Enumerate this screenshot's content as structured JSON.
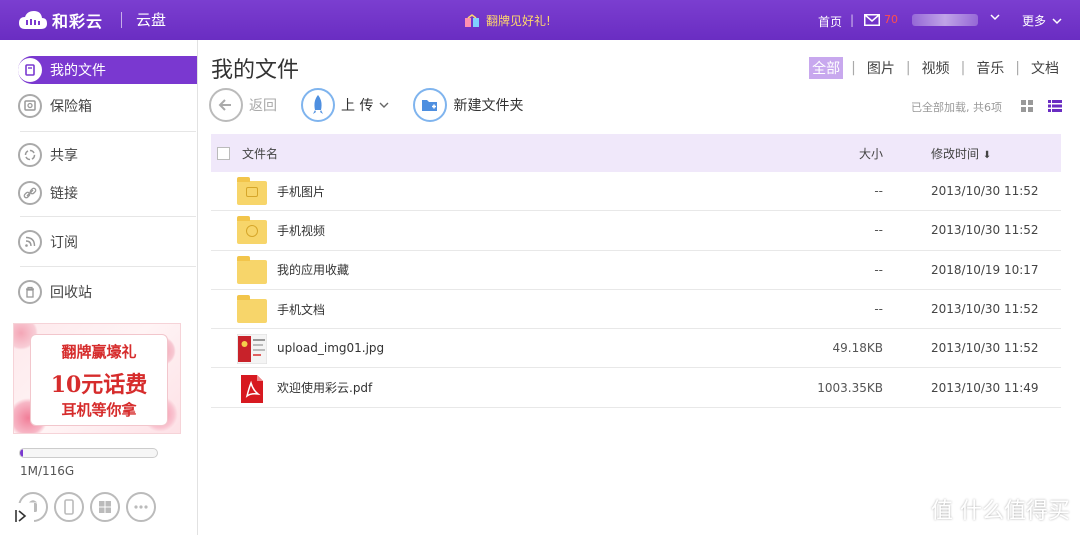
{
  "header": {
    "brand": "和彩云",
    "app_name": "云盘",
    "promo": "翻牌见好礼!",
    "home": "首页",
    "sep": "|",
    "mail_count": "70",
    "more": "更多"
  },
  "sidebar": {
    "items": [
      {
        "label": "我的文件",
        "icon": "my-files-icon"
      },
      {
        "label": "保险箱",
        "icon": "safe-icon"
      },
      {
        "label": "共享",
        "icon": "share-icon"
      },
      {
        "label": "链接",
        "icon": "link-icon"
      },
      {
        "label": "订阅",
        "icon": "rss-icon"
      },
      {
        "label": "回收站",
        "icon": "recycle-bin-icon"
      }
    ],
    "ad": {
      "line1": "翻牌赢壕礼",
      "line2": "10元话费",
      "line3": "耳机等你拿"
    },
    "storage": {
      "text": "1M/116G",
      "used_fraction": 0.02
    },
    "clients": [
      "android-icon",
      "phone-icon",
      "windows-icon",
      "more-icon"
    ]
  },
  "main": {
    "title": "我的文件",
    "filters": [
      "全部",
      "图片",
      "视频",
      "音乐",
      "文档"
    ],
    "active_filter": "全部",
    "toolbar": {
      "back": "返回",
      "upload": "上 传",
      "new_folder": "新建文件夹"
    },
    "loaded_text": "已全部加载, 共6项",
    "columns": {
      "name": "文件名",
      "size": "大小",
      "time": "修改时间"
    },
    "sort_arrow": "⬇",
    "files": [
      {
        "name": "手机图片",
        "size": "--",
        "time": "2013/10/30 11:52",
        "type": "folder-image"
      },
      {
        "name": "手机视频",
        "size": "--",
        "time": "2013/10/30 11:52",
        "type": "folder-video"
      },
      {
        "name": "我的应用收藏",
        "size": "--",
        "time": "2018/10/19 10:17",
        "type": "folder"
      },
      {
        "name": "手机文档",
        "size": "--",
        "time": "2013/10/30 11:52",
        "type": "folder"
      },
      {
        "name": "upload_img01.jpg",
        "size": "49.18KB",
        "time": "2013/10/30 11:52",
        "type": "jpg"
      },
      {
        "name": "欢迎使用彩云.pdf",
        "size": "1003.35KB",
        "time": "2013/10/30 11:49",
        "type": "pdf"
      }
    ]
  },
  "watermark": "值 什么值得买"
}
